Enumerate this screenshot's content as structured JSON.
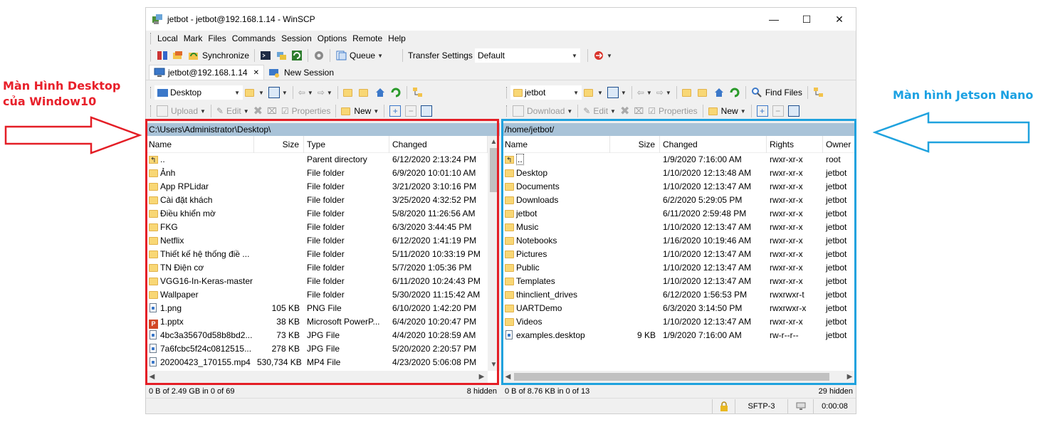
{
  "annotations": {
    "left_line1": "Màn Hình Desktop",
    "left_line2": "của Window10",
    "right": "Màn hình Jetson Nano"
  },
  "window": {
    "title": "jetbot - jetbot@192.168.1.14 - WinSCP",
    "minimize": "—",
    "maximize": "☐",
    "close": "✕"
  },
  "menu": [
    "Local",
    "Mark",
    "Files",
    "Commands",
    "Session",
    "Options",
    "Remote",
    "Help"
  ],
  "toolbar": {
    "synchronize": "Synchronize",
    "queue": "Queue",
    "transfer_settings_label": "Transfer Settings",
    "transfer_settings_value": "Default"
  },
  "tabs": {
    "session": "jetbot@192.168.1.14",
    "new_session": "New Session"
  },
  "local": {
    "location": "Desktop",
    "actions": {
      "upload": "Upload",
      "edit": "Edit",
      "properties": "Properties",
      "new": "New"
    },
    "path": "C:\\Users\\Administrator\\Desktop\\",
    "columns": {
      "name": "Name",
      "size": "Size",
      "type": "Type",
      "changed": "Changed"
    },
    "rows": [
      {
        "name": "..",
        "size": "",
        "type": "Parent directory",
        "changed": "6/12/2020  2:13:24 PM",
        "icon": "up"
      },
      {
        "name": "Ảnh",
        "size": "",
        "type": "File folder",
        "changed": "6/9/2020  10:01:10 AM",
        "icon": "folder"
      },
      {
        "name": "App RPLidar",
        "size": "",
        "type": "File folder",
        "changed": "3/21/2020  3:10:16 PM",
        "icon": "folder"
      },
      {
        "name": "Cài đặt khách",
        "size": "",
        "type": "File folder",
        "changed": "3/25/2020  4:32:52 PM",
        "icon": "folder"
      },
      {
        "name": "Điều khiển mờ",
        "size": "",
        "type": "File folder",
        "changed": "5/8/2020  11:26:56 AM",
        "icon": "folder"
      },
      {
        "name": "FKG",
        "size": "",
        "type": "File folder",
        "changed": "6/3/2020  3:44:45 PM",
        "icon": "folder"
      },
      {
        "name": "Netflix",
        "size": "",
        "type": "File folder",
        "changed": "6/12/2020  1:41:19 PM",
        "icon": "folder"
      },
      {
        "name": "Thiết kế hệ thống điề ...",
        "size": "",
        "type": "File folder",
        "changed": "5/11/2020  10:33:19 PM",
        "icon": "folder"
      },
      {
        "name": "TN Điện cơ",
        "size": "",
        "type": "File folder",
        "changed": "5/7/2020  1:05:36 PM",
        "icon": "folder"
      },
      {
        "name": "VGG16-In-Keras-master",
        "size": "",
        "type": "File folder",
        "changed": "6/11/2020  10:24:43 PM",
        "icon": "folder"
      },
      {
        "name": "Wallpaper",
        "size": "",
        "type": "File folder",
        "changed": "5/30/2020  11:15:42 AM",
        "icon": "folder"
      },
      {
        "name": "1.png",
        "size": "105 KB",
        "type": "PNG File",
        "changed": "6/10/2020  1:42:20 PM",
        "icon": "file"
      },
      {
        "name": "1.pptx",
        "size": "38 KB",
        "type": "Microsoft PowerP...",
        "changed": "6/4/2020  10:20:47 PM",
        "icon": "ppt"
      },
      {
        "name": "4bc3a35670d58b8bd2...",
        "size": "73 KB",
        "type": "JPG File",
        "changed": "4/4/2020  10:28:59 AM",
        "icon": "file"
      },
      {
        "name": "7a6fcbc5f24c0812515...",
        "size": "278 KB",
        "type": "JPG File",
        "changed": "5/20/2020  2:20:57 PM",
        "icon": "file"
      },
      {
        "name": "20200423_170155.mp4",
        "size": "530,734 KB",
        "type": "MP4 File",
        "changed": "4/23/2020  5:06:08 PM",
        "icon": "file"
      }
    ],
    "status": "0 B of 2.49 GB in 0 of 69",
    "hidden": "8 hidden"
  },
  "remote": {
    "location": "jetbot",
    "find_files": "Find Files",
    "actions": {
      "download": "Download",
      "edit": "Edit",
      "properties": "Properties",
      "new": "New"
    },
    "path": "/home/jetbot/",
    "columns": {
      "name": "Name",
      "size": "Size",
      "changed": "Changed",
      "rights": "Rights",
      "owner": "Owner"
    },
    "rows": [
      {
        "name": "..",
        "size": "",
        "changed": "1/9/2020 7:16:00 AM",
        "rights": "rwxr-xr-x",
        "owner": "root",
        "icon": "up"
      },
      {
        "name": "Desktop",
        "size": "",
        "changed": "1/10/2020 12:13:48 AM",
        "rights": "rwxr-xr-x",
        "owner": "jetbot",
        "icon": "folder"
      },
      {
        "name": "Documents",
        "size": "",
        "changed": "1/10/2020 12:13:47 AM",
        "rights": "rwxr-xr-x",
        "owner": "jetbot",
        "icon": "folder"
      },
      {
        "name": "Downloads",
        "size": "",
        "changed": "6/2/2020 5:29:05 PM",
        "rights": "rwxr-xr-x",
        "owner": "jetbot",
        "icon": "folder"
      },
      {
        "name": "jetbot",
        "size": "",
        "changed": "6/11/2020 2:59:48 PM",
        "rights": "rwxr-xr-x",
        "owner": "jetbot",
        "icon": "folder"
      },
      {
        "name": "Music",
        "size": "",
        "changed": "1/10/2020 12:13:47 AM",
        "rights": "rwxr-xr-x",
        "owner": "jetbot",
        "icon": "folder"
      },
      {
        "name": "Notebooks",
        "size": "",
        "changed": "1/16/2020 10:19:46 AM",
        "rights": "rwxr-xr-x",
        "owner": "jetbot",
        "icon": "folder"
      },
      {
        "name": "Pictures",
        "size": "",
        "changed": "1/10/2020 12:13:47 AM",
        "rights": "rwxr-xr-x",
        "owner": "jetbot",
        "icon": "folder"
      },
      {
        "name": "Public",
        "size": "",
        "changed": "1/10/2020 12:13:47 AM",
        "rights": "rwxr-xr-x",
        "owner": "jetbot",
        "icon": "folder"
      },
      {
        "name": "Templates",
        "size": "",
        "changed": "1/10/2020 12:13:47 AM",
        "rights": "rwxr-xr-x",
        "owner": "jetbot",
        "icon": "folder"
      },
      {
        "name": "thinclient_drives",
        "size": "",
        "changed": "6/12/2020 1:56:53 PM",
        "rights": "rwxrwxr-t",
        "owner": "jetbot",
        "icon": "folder"
      },
      {
        "name": "UARTDemo",
        "size": "",
        "changed": "6/3/2020 3:14:50 PM",
        "rights": "rwxrwxr-x",
        "owner": "jetbot",
        "icon": "folder"
      },
      {
        "name": "Videos",
        "size": "",
        "changed": "1/10/2020 12:13:47 AM",
        "rights": "rwxr-xr-x",
        "owner": "jetbot",
        "icon": "folder"
      },
      {
        "name": "examples.desktop",
        "size": "9 KB",
        "changed": "1/9/2020 7:16:00 AM",
        "rights": "rw-r--r--",
        "owner": "jetbot",
        "icon": "file"
      }
    ],
    "status": "0 B of 8.76 KB in 0 of 13",
    "hidden": "29 hidden"
  },
  "bottom": {
    "protocol": "SFTP-3",
    "elapsed": "0:00:08"
  }
}
